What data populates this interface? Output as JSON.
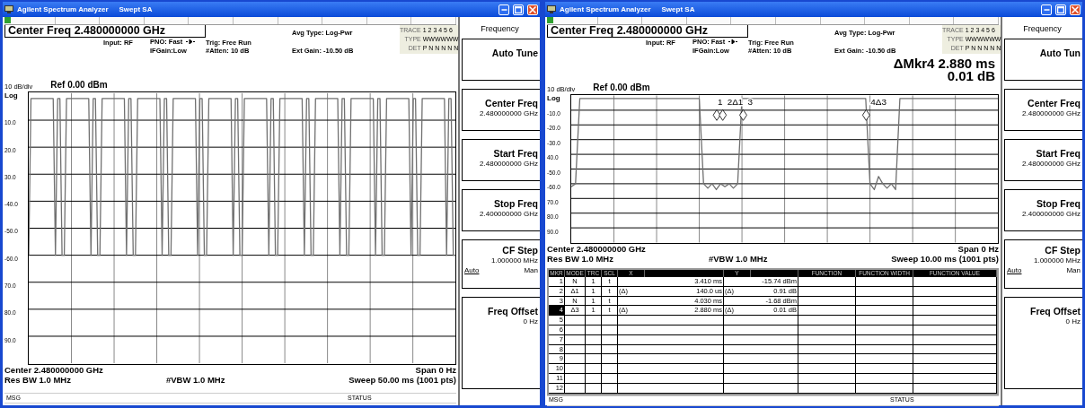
{
  "windows": [
    {
      "title": "Agilent Spectrum Analyzer",
      "mode": "Swept SA",
      "header": {
        "center_freq": "Center Freq  2.480000000 GHz",
        "input": "Input: RF",
        "pno": "PNO: Fast",
        "ifgain": "IFGain:Low",
        "trig": "Trig: Free Run",
        "atten": "#Atten: 10 dB",
        "avg_type": "Avg Type: Log-Pwr",
        "ext_gain": "Ext Gain: -10.50 dB"
      },
      "trace_info": {
        "labels": [
          "TRACE",
          "TYPE",
          "DET"
        ],
        "values": [
          "1 2 3 4 5 6",
          "WWWWWW",
          "P N N N N N"
        ]
      },
      "scale": "10 dB/div",
      "ref": "Ref 0.00 dBm",
      "log": "Log",
      "chart_data": {
        "type": "line",
        "ylim": [
          -100,
          0
        ],
        "grid": true,
        "yticks": [
          {
            "value": -10,
            "label": "10.0"
          },
          {
            "value": -20,
            "label": "20.0"
          },
          {
            "value": -30,
            "label": "30.0"
          },
          {
            "value": -40,
            "label": "-40.0"
          },
          {
            "value": -50,
            "label": "-50.0"
          },
          {
            "value": -60,
            "label": "-60.0"
          },
          {
            "value": -70,
            "label": "70.0"
          },
          {
            "value": -80,
            "label": "80.0"
          },
          {
            "value": -90,
            "label": "90.0"
          }
        ],
        "categories": [
          null,
          null,
          null,
          null,
          null,
          null,
          null,
          null,
          null,
          null,
          null,
          null,
          null,
          null,
          null,
          null,
          null,
          null,
          null,
          null,
          null,
          null,
          null,
          null,
          null,
          null,
          null,
          null,
          null,
          null,
          null,
          null,
          null,
          null,
          null,
          null,
          null,
          null,
          null,
          null,
          null,
          null,
          null,
          null,
          null,
          null,
          null,
          null,
          null,
          null,
          null,
          null,
          null,
          null,
          null,
          null,
          null,
          null,
          null,
          null,
          null,
          null,
          null,
          null,
          null,
          null,
          null,
          null,
          null,
          null,
          null,
          null,
          null,
          null,
          null,
          null,
          null,
          null,
          null,
          null,
          null,
          null,
          null,
          null,
          null,
          null,
          null,
          null,
          null,
          null,
          null,
          null,
          null,
          null,
          null,
          null,
          null,
          null,
          null,
          null,
          null,
          null,
          null,
          null,
          null,
          null,
          null,
          null,
          null,
          null,
          null,
          null,
          null,
          null,
          null,
          null,
          null,
          null,
          null,
          null,
          null,
          null,
          null,
          null,
          null,
          null,
          null,
          null,
          null,
          null,
          null,
          null,
          null,
          null,
          null,
          null,
          null,
          null,
          null,
          null,
          null,
          null,
          null,
          null,
          null,
          null,
          null,
          null,
          null,
          null,
          null,
          null,
          null,
          null,
          null,
          null,
          null,
          null,
          null,
          null,
          null,
          null,
          null,
          null,
          null,
          null,
          null,
          null,
          null,
          null,
          null,
          null,
          null,
          null,
          null,
          null,
          null,
          null,
          null,
          null,
          null,
          null,
          null,
          null,
          null,
          null,
          null,
          null,
          null,
          null,
          null,
          null,
          null
        ],
        "series": [
          {
            "color": "#707070",
            "values": [
              -60,
              -2,
              -2,
              -2,
              -2,
              -2,
              -2,
              -2,
              -2,
              -2,
              -2,
              -2,
              -60,
              -2,
              -2,
              -60,
              -60,
              -2,
              -2,
              -2,
              -2,
              -2,
              -2,
              -2,
              -2,
              -2,
              -2,
              -2,
              -60,
              -2,
              -2,
              -60,
              -60,
              -2,
              -2,
              -2,
              -2,
              -2,
              -2,
              -2,
              -2,
              -2,
              -2,
              -2,
              -60,
              -2,
              -2,
              -60,
              -60,
              -2,
              -2,
              -2,
              -2,
              -2,
              -2,
              -2,
              -2,
              -2,
              -2,
              -2,
              -60,
              -2,
              -2,
              -60,
              -60,
              -2,
              -2,
              -2,
              -2,
              -2,
              -2,
              -2,
              -2,
              -2,
              -2,
              -2,
              -60,
              -2,
              -2,
              -60,
              -60,
              -2,
              -2,
              -2,
              -2,
              -2,
              -2,
              -2,
              -2,
              -2,
              -2,
              -2,
              -60,
              -2,
              -2,
              -60,
              -60,
              -2,
              -2,
              -2,
              -2,
              -2,
              -2,
              -2,
              -2,
              -2,
              -2,
              -2,
              -60,
              -2,
              -2,
              -60,
              -60,
              -2,
              -2,
              -2,
              -2,
              -2,
              -2,
              -2,
              -2,
              -2,
              -2,
              -2,
              -60,
              -2,
              -2,
              -60,
              -60,
              -2,
              -2,
              -2,
              -2,
              -2,
              -2,
              -2,
              -2,
              -2,
              -2,
              -2,
              -60,
              -2,
              -2,
              -60,
              -60,
              -2,
              -2,
              -2,
              -2,
              -2,
              -2,
              -2,
              -2,
              -2,
              -2,
              -2,
              -60,
              -2,
              -2,
              -60,
              -60,
              -2,
              -2,
              -2,
              -2,
              -2,
              -2,
              -2,
              -2,
              -2,
              -2,
              -2,
              -60,
              -2,
              -2,
              -60,
              -60,
              -2,
              -2,
              -2,
              -2,
              -2,
              -2,
              -2,
              -2,
              -2,
              -2,
              -2,
              -60,
              -2,
              -2,
              -60,
              -60
            ]
          }
        ]
      },
      "footer": {
        "center": "Center 2.480000000 GHz",
        "span": "Span 0 Hz",
        "rbw": "Res BW 1.0 MHz",
        "vbw": "#VBW 1.0 MHz",
        "sweep": "Sweep  50.00 ms (1001 pts)"
      },
      "status": {
        "msg": "MSG",
        "status": "STATUS"
      },
      "softkeys": {
        "menu": "Frequency",
        "keys": [
          {
            "kind": "plain",
            "label": "Auto Tune"
          },
          {
            "kind": "value",
            "label": "Center Freq",
            "value": "2.480000000 GHz"
          },
          {
            "kind": "value",
            "label": "Start Freq",
            "value": "2.480000000 GHz"
          },
          {
            "kind": "value",
            "label": "Stop Freq",
            "value": "2.400000000 GHz"
          },
          {
            "kind": "toggle",
            "label": "CF Step",
            "value": "1.000000 MHz",
            "options": [
              {
                "label": "Auto",
                "selected": true
              },
              {
                "label": "Man",
                "selected": false
              }
            ]
          },
          {
            "kind": "value",
            "label": "Freq Offset",
            "value": "0 Hz"
          }
        ]
      }
    },
    {
      "title": "Agilent Spectrum Analyzer",
      "mode": "Swept SA",
      "header": {
        "center_freq": "Center Freq  2.480000000 GHz",
        "input": "Input: RF",
        "pno": "PNO: Fast",
        "ifgain": "IFGain:Low",
        "trig": "Trig: Free Run",
        "atten": "#Atten: 10 dB",
        "avg_type": "Avg Type: Log-Pwr",
        "ext_gain": "Ext Gain: -10.50 dB"
      },
      "trace_info": {
        "labels": [
          "TRACE",
          "TYPE",
          "DET"
        ],
        "values": [
          "1 2 3 4 5 6",
          "WWWWWW",
          "P N N N N N"
        ]
      },
      "readout": [
        "ΔMkr4 2.880 ms",
        "0.01 dB"
      ],
      "scale": "10 dB/div",
      "ref": "Ref 0.00 dBm",
      "log": "Log",
      "chart_data": {
        "type": "line",
        "ylim": [
          -100,
          0
        ],
        "grid": true,
        "yticks": [
          {
            "value": -10,
            "label": "-10.0"
          },
          {
            "value": -20,
            "label": "-20.0"
          },
          {
            "value": -30,
            "label": "-30.0"
          },
          {
            "value": -40,
            "label": "40.0"
          },
          {
            "value": -50,
            "label": "-50.0"
          },
          {
            "value": -60,
            "label": "-60.0"
          },
          {
            "value": -70,
            "label": "70.0"
          },
          {
            "value": -80,
            "label": "80.0"
          },
          {
            "value": -90,
            "label": "90.0"
          }
        ],
        "categories": [
          null,
          null,
          null,
          null,
          null,
          null,
          null,
          null,
          null,
          null,
          null,
          null,
          null,
          null,
          null,
          null,
          null,
          null,
          null,
          null,
          null,
          null,
          null,
          null,
          null,
          null,
          null,
          null,
          null,
          null,
          null,
          null,
          null,
          null,
          null,
          null,
          null,
          null,
          null,
          null,
          null,
          null,
          null,
          null,
          null,
          null,
          null,
          null,
          null,
          null,
          null,
          null,
          null,
          null,
          null,
          null,
          null,
          null,
          null,
          null,
          null,
          null,
          null,
          null,
          null,
          null,
          null,
          null,
          null,
          null,
          null,
          null,
          null,
          null,
          null,
          null,
          null,
          null,
          null,
          null,
          null,
          null,
          null,
          null,
          null,
          null,
          null,
          null,
          null,
          null,
          null,
          null,
          null,
          null,
          null,
          null,
          null,
          null,
          null,
          null,
          null
        ],
        "series": [
          {
            "color": "#707070",
            "values": [
              -62,
              -60,
              -2,
              -2,
              -2,
              -2,
              -2,
              -2,
              -2,
              -2,
              -2,
              -2,
              -2,
              -2,
              -2,
              -2,
              -2,
              -2,
              -2,
              -2,
              -2,
              -2,
              -2,
              -2,
              -2,
              -2,
              -2,
              -2,
              -2,
              -2,
              -2,
              -60,
              -63,
              -60,
              -64,
              -60,
              -62,
              -60,
              -63,
              -60,
              -2,
              -2,
              -2,
              -2,
              -2,
              -2,
              -2,
              -2,
              -2,
              -2,
              -2,
              -2,
              -2,
              -2,
              -2,
              -2,
              -2,
              -2,
              -2,
              -2,
              -2,
              -2,
              -2,
              -2,
              -2,
              -2,
              -2,
              -2,
              -2,
              -2,
              -60,
              -64,
              -55,
              -60,
              -63,
              -60,
              -64,
              -2,
              -2,
              -2,
              -2,
              -2,
              -2,
              -2,
              -2,
              -2,
              -2,
              -2,
              -2,
              -2,
              -2,
              -2,
              -2,
              -2,
              -2,
              -2,
              -2,
              -2,
              -2,
              -2,
              -2
            ]
          }
        ]
      },
      "markers": [
        "1",
        "2Δ1",
        "3",
        "4Δ3"
      ],
      "footer": {
        "center": "Center 2.480000000 GHz",
        "span": "Span 0 Hz",
        "rbw": "Res BW 1.0 MHz",
        "vbw": "#VBW 1.0 MHz",
        "sweep": "Sweep  10.00 ms (1001 pts)"
      },
      "marker_table": {
        "columns": [
          "MKR",
          "MODE",
          "TRC",
          "SCL",
          "X",
          "",
          "Y",
          "",
          "FUNCTION",
          "FUNCTION WIDTH",
          "FUNCTION VALUE"
        ],
        "rows": [
          {
            "mkr": "1",
            "mode": "N",
            "trc": "1",
            "scl": "t",
            "x": "3.410 ms",
            "y": "-15.74 dBm",
            "selected": false
          },
          {
            "mkr": "2",
            "mode": "Δ1",
            "trc": "1",
            "scl": "t",
            "x_ref": "(Δ)",
            "x": "140.0 us",
            "y_ref": "(Δ)",
            "y": "0.91 dB",
            "selected": false
          },
          {
            "mkr": "3",
            "mode": "N",
            "trc": "1",
            "scl": "t",
            "x": "4.030 ms",
            "y": "-1.68 dBm",
            "selected": false
          },
          {
            "mkr": "4",
            "mode": "Δ3",
            "trc": "1",
            "scl": "t",
            "x_ref": "(Δ)",
            "x": "2.880 ms",
            "y_ref": "(Δ)",
            "y": "0.01 dB",
            "selected": true
          },
          {
            "mkr": "5",
            "selected": false
          },
          {
            "mkr": "6",
            "selected": false
          },
          {
            "mkr": "7",
            "selected": false
          },
          {
            "mkr": "8",
            "selected": false
          },
          {
            "mkr": "9",
            "selected": false
          },
          {
            "mkr": "10",
            "selected": false
          },
          {
            "mkr": "11",
            "selected": false
          },
          {
            "mkr": "12",
            "selected": false
          }
        ]
      },
      "status": {
        "msg": "MSG",
        "status": "STATUS"
      },
      "softkeys": {
        "menu": "Frequency",
        "keys": [
          {
            "kind": "plain",
            "label": "Auto Tun"
          },
          {
            "kind": "value",
            "label": "Center Freq",
            "value": "2.480000000 GHz"
          },
          {
            "kind": "value",
            "label": "Start Freq",
            "value": "2.480000000 GHz"
          },
          {
            "kind": "value",
            "label": "Stop Freq",
            "value": "2.400000000 GHz"
          },
          {
            "kind": "toggle",
            "label": "CF Step",
            "value": "1.000000 MHz",
            "options": [
              {
                "label": "Auto",
                "selected": true
              },
              {
                "label": "Man",
                "selected": false
              }
            ]
          },
          {
            "kind": "value",
            "label": "Freq Offset",
            "value": "0 Hz"
          }
        ]
      }
    }
  ]
}
